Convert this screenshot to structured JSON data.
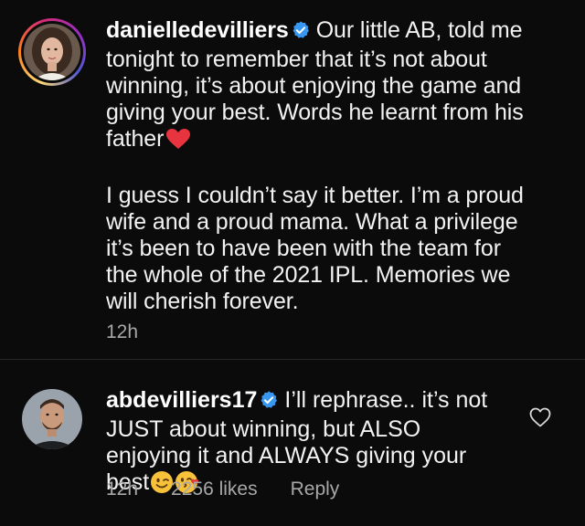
{
  "post_caption": {
    "username": "danielledevilliers",
    "verified": true,
    "paragraph1": "Our little AB, told me tonight to remember that it’s not about winning, it’s about enjoying the game and giving your best. Words he learnt from his father",
    "paragraph1_emoji": "red-heart-icon",
    "paragraph2": "I guess I couldn’t say it better. I’m a proud wife and a proud mama. What a privilege it’s been to have been with the team for the whole of the 2021 IPL. Memories we will cherish forever.",
    "time": "12h"
  },
  "reply_comment": {
    "username": "abdevilliers17",
    "verified": true,
    "text": "I’ll rephrase.. it’s not JUST about winning, but ALSO enjoying it and ALWAYS giving your best",
    "emojis": [
      "winking-face-icon",
      "face-blowing-kiss-icon"
    ],
    "time": "12h",
    "likes": "2256 likes",
    "reply_label": "Reply"
  },
  "colors": {
    "background": "#0b0b0b",
    "text": "#f5f5f5",
    "muted": "#a8a8a8",
    "verified": "#3897f0",
    "heart": "#ed4956"
  }
}
